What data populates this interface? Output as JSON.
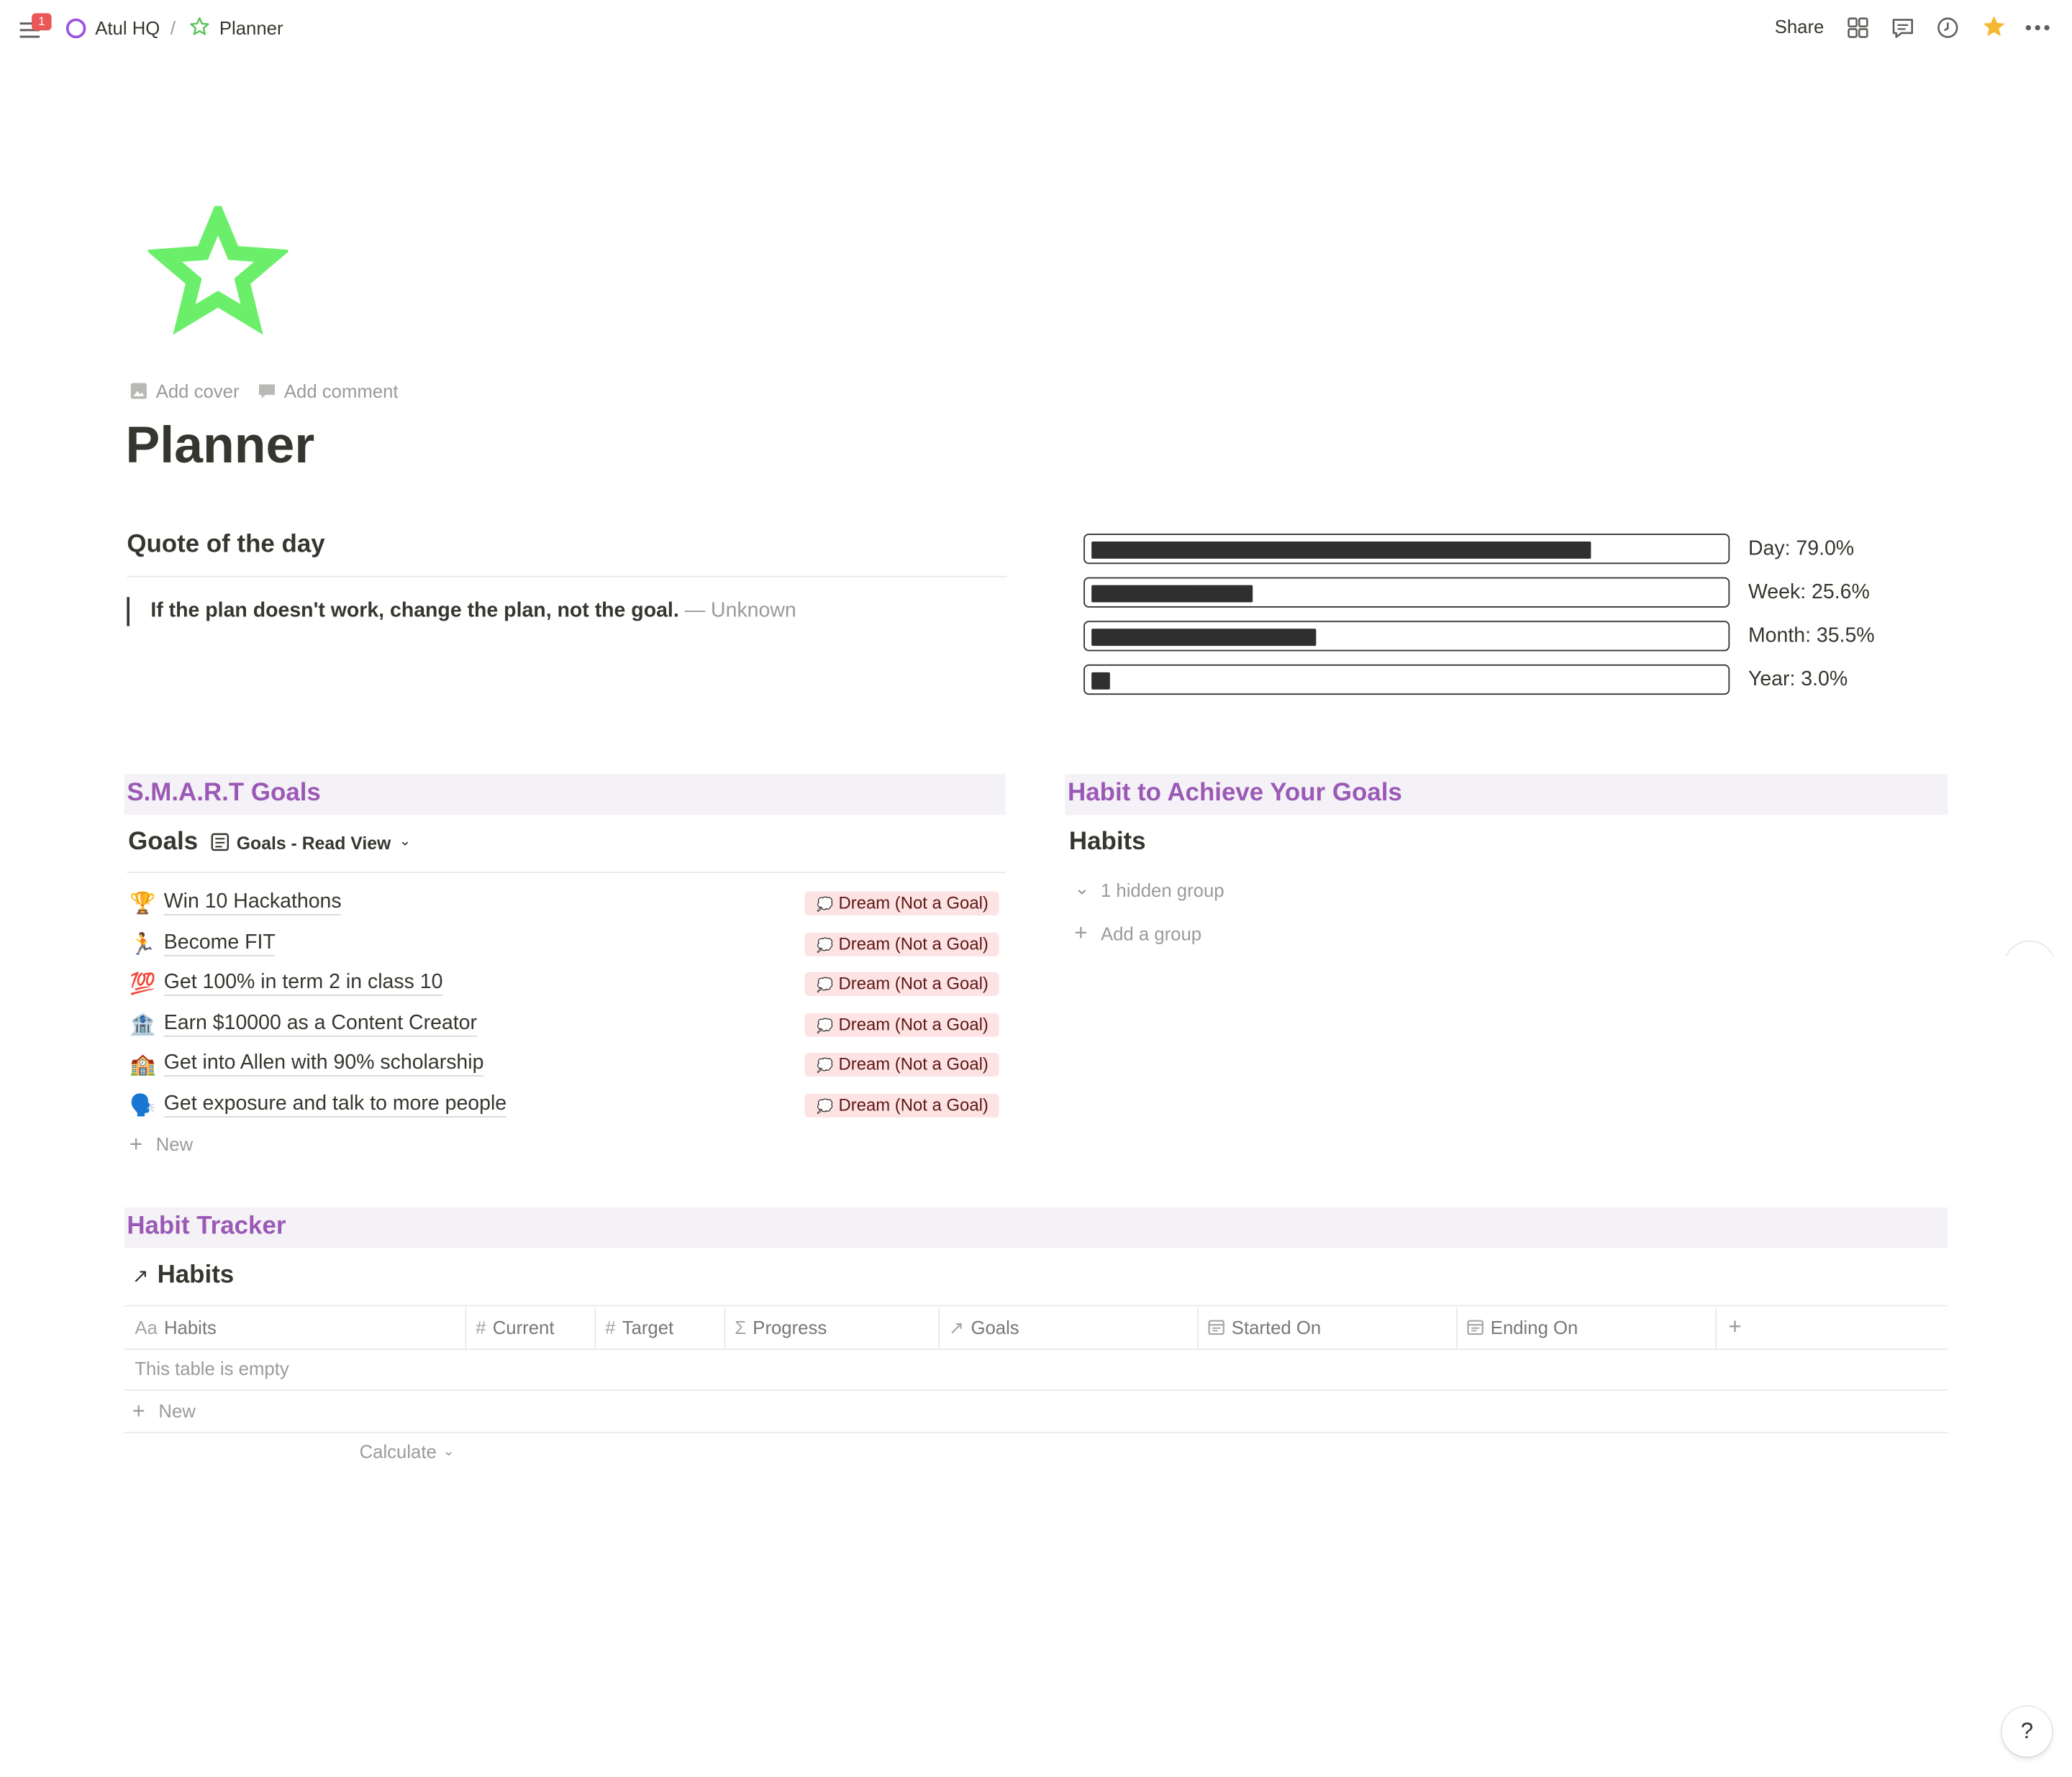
{
  "topbar": {
    "notification_count": "1",
    "workspace": "Atul HQ",
    "separator": "/",
    "page_name": "Planner",
    "share_label": "Share"
  },
  "page_icon": "green-star-icon",
  "page_actions": {
    "add_cover": "Add cover",
    "add_comment": "Add comment"
  },
  "title": "Planner",
  "quote": {
    "heading": "Quote of the day",
    "text": "If the plan doesn't work, change the plan, not the goal.",
    "author": "— Unknown"
  },
  "progress": [
    {
      "label": "Day: 79.0%",
      "value": 0.79
    },
    {
      "label": "Week: 25.6%",
      "value": 0.256
    },
    {
      "label": "Month: 35.5%",
      "value": 0.355
    },
    {
      "label": "Year: 3.0%",
      "value": 0.03
    }
  ],
  "smart_goals": {
    "heading": "S.M.A.R.T Goals",
    "db_title": "Goals",
    "view_name": "Goals - Read View",
    "items": [
      {
        "emoji": "🏆",
        "title": "Win 10 Hackathons",
        "tag": "Dream (Not a Goal)"
      },
      {
        "emoji": "🏃",
        "title": "Become FIT",
        "tag": "Dream (Not a Goal)"
      },
      {
        "emoji": "💯",
        "title": "Get 100% in term 2 in class 10",
        "tag": "Dream (Not a Goal)"
      },
      {
        "emoji": "🏦",
        "title": "Earn $10000 as a Content Creator",
        "tag": "Dream (Not a Goal)"
      },
      {
        "emoji": "🏫",
        "title": "Get into Allen with 90% scholarship",
        "tag": "Dream (Not a Goal)"
      },
      {
        "emoji": "🗣️",
        "title": "Get exposure and talk to more people",
        "tag": "Dream (Not a Goal)"
      }
    ],
    "new_label": "New"
  },
  "habits_goals": {
    "heading": "Habit to Achieve Your Goals",
    "db_title": "Habits",
    "hidden_group": "1 hidden group",
    "add_group": "Add a group"
  },
  "habit_tracker": {
    "heading": "Habit Tracker",
    "db_title": "Habits",
    "columns": [
      {
        "icon": "Aa",
        "label": "Habits"
      },
      {
        "icon": "#",
        "label": "Current"
      },
      {
        "icon": "#",
        "label": "Target"
      },
      {
        "icon": "Σ",
        "label": "Progress"
      },
      {
        "icon": "↗",
        "label": "Goals"
      },
      {
        "icon": "calendar-icon",
        "label": "Started On"
      },
      {
        "icon": "calendar-icon",
        "label": "Ending On"
      }
    ],
    "empty_text": "This table is empty",
    "new_label": "New",
    "calculate_label": "Calculate"
  },
  "help_label": "?"
}
